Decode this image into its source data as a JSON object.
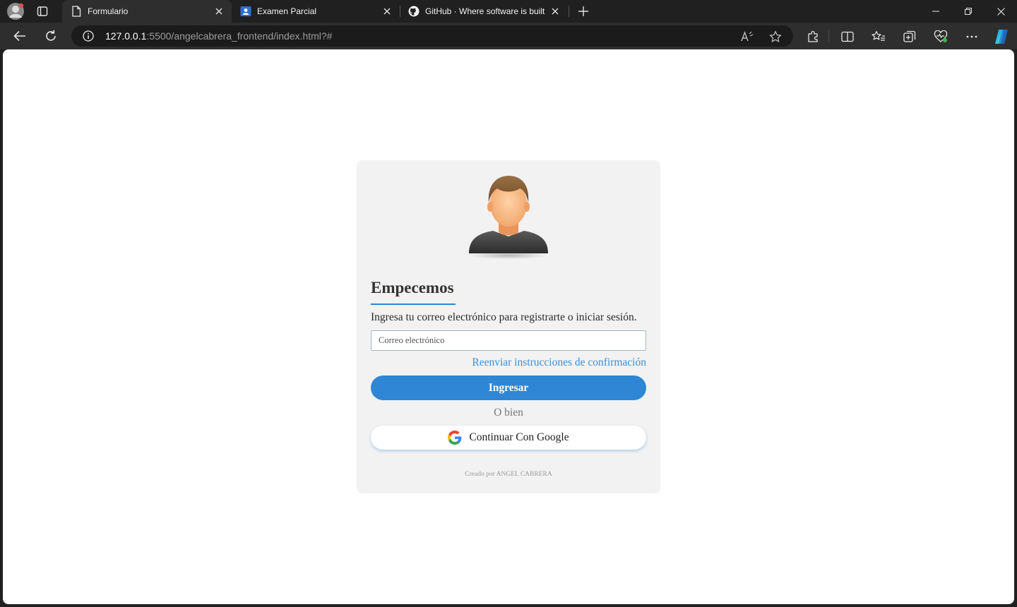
{
  "browser": {
    "tabs": [
      {
        "title": "Formulario",
        "icon": "document-icon",
        "active": true
      },
      {
        "title": "Examen Parcial",
        "icon": "classroom-icon",
        "active": false
      },
      {
        "title": "GitHub · Where software is built",
        "icon": "github-icon",
        "active": false
      }
    ],
    "url_host": "127.0.0.1",
    "url_rest": ":5500/angelcabrera_frontend/index.html?#"
  },
  "page": {
    "title": "Empecemos",
    "subtitle": "Ingresa tu correo electrónico para registrarte o iniciar sesión.",
    "email_placeholder": "Correo electrónico",
    "email_value": "",
    "resend_link": "Reenviar instrucciones de confirmación",
    "primary_button": "Ingresar",
    "separator": "O bien",
    "google_button": "Continuar Con Google",
    "credit": "Creado por ANGEL CABRERA"
  },
  "colors": {
    "accent": "#2e86d4",
    "card_background": "#f2f2f2",
    "browser_chrome": "#202020"
  }
}
